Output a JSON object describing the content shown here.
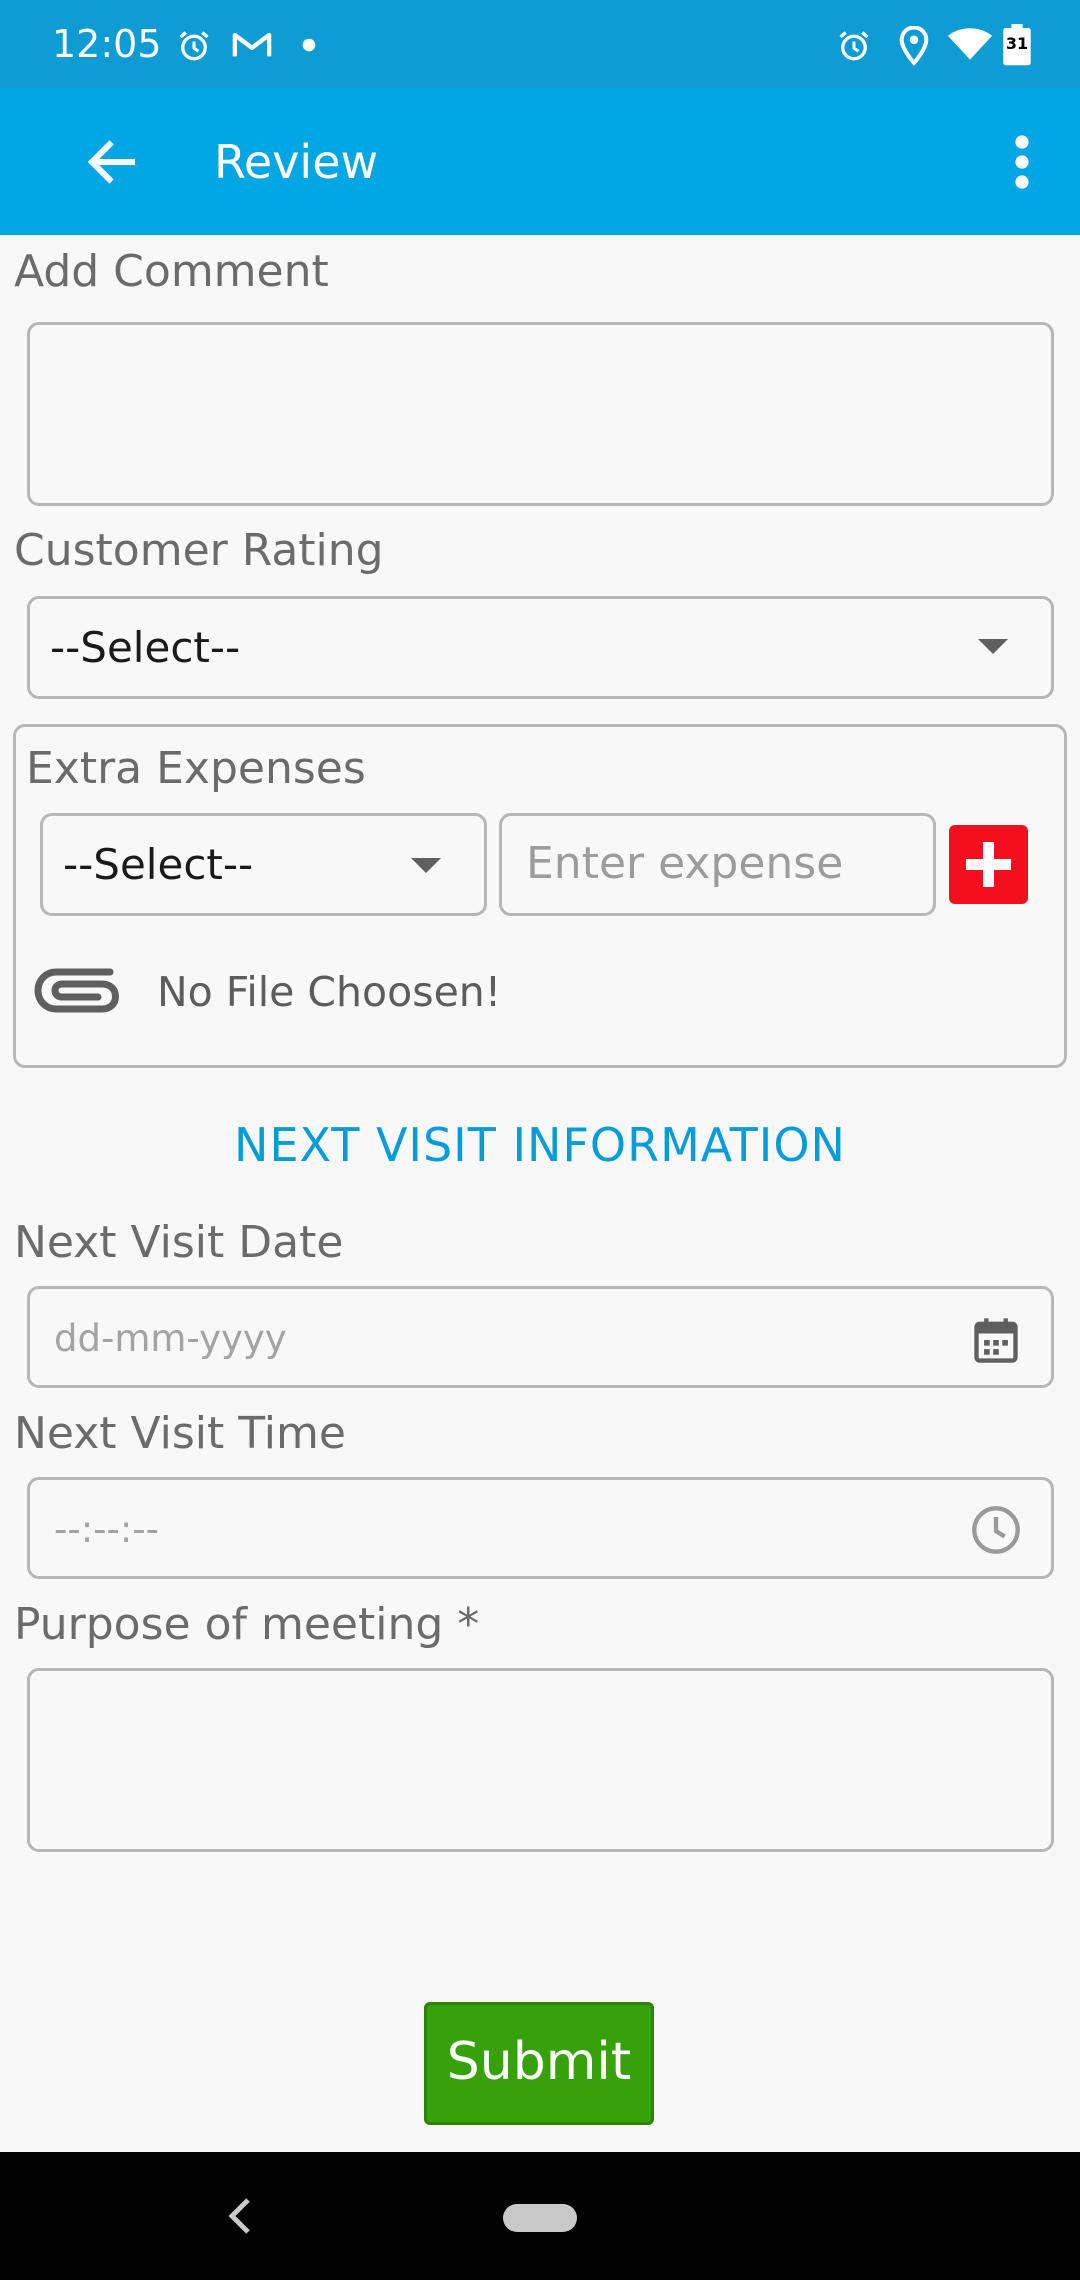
{
  "status_bar": {
    "time": "12:05",
    "calendar_day": "31"
  },
  "app_bar": {
    "title": "Review"
  },
  "form": {
    "comment_label": "Add Comment",
    "rating_label": "Customer Rating",
    "rating_value": "--Select--",
    "expenses": {
      "label": "Extra Expenses",
      "type_value": "--Select--",
      "amount_placeholder": "Enter expense",
      "file_status": "No File Choosen!"
    },
    "next_visit_heading": "NEXT VISIT INFORMATION",
    "date_label": "Next Visit Date",
    "date_placeholder": "dd-mm-yyyy",
    "time_label": "Next Visit Time",
    "time_placeholder": "--:--:--",
    "purpose_label": "Purpose of meeting *",
    "submit_label": "Submit"
  },
  "colors": {
    "status_bar": "#0f9bd4",
    "app_bar": "#02a6e2",
    "accent_text": "#069bd9",
    "submit": "#37a10b",
    "add_button": "#f2101f"
  }
}
